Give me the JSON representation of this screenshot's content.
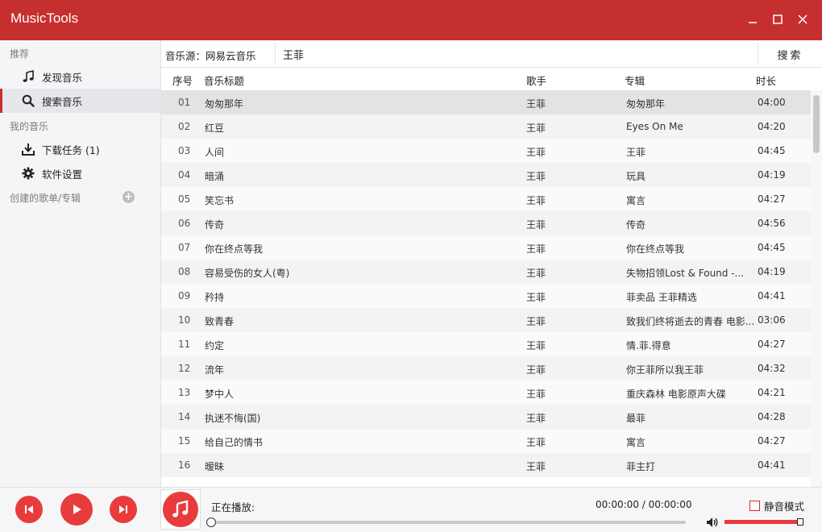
{
  "app": {
    "title": "MusicTools"
  },
  "window_controls": {
    "minimize": "minimize",
    "maximize": "maximize",
    "close": "close"
  },
  "sidebar": {
    "section_recommend": "推荐",
    "item_discover": "发现音乐",
    "item_search": "搜索音乐",
    "section_my_music": "我的音乐",
    "item_download": "下载任务 (1)",
    "item_settings": "软件设置",
    "section_playlists": "创建的歌单/专辑",
    "add_symbol": "+"
  },
  "search": {
    "source_label": "音乐源：网易云音乐",
    "query": "王菲",
    "button_label": "搜索"
  },
  "table": {
    "headers": {
      "index": "序号",
      "title": "音乐标题",
      "artist": "歌手",
      "album": "专辑",
      "duration": "时长"
    },
    "rows": [
      {
        "index": "01",
        "title": "匆匆那年",
        "artist": "王菲",
        "album": "匆匆那年",
        "duration": "04:00"
      },
      {
        "index": "02",
        "title": "红豆",
        "artist": "王菲",
        "album": "Eyes On Me",
        "duration": "04:20"
      },
      {
        "index": "03",
        "title": "人间",
        "artist": "王菲",
        "album": "王菲",
        "duration": "04:45"
      },
      {
        "index": "04",
        "title": "暗涌",
        "artist": "王菲",
        "album": "玩具",
        "duration": "04:19"
      },
      {
        "index": "05",
        "title": "笑忘书",
        "artist": "王菲",
        "album": "寓言",
        "duration": "04:27"
      },
      {
        "index": "06",
        "title": "传奇",
        "artist": "王菲",
        "album": "传奇",
        "duration": "04:56"
      },
      {
        "index": "07",
        "title": "你在终点等我",
        "artist": "王菲",
        "album": "你在终点等我",
        "duration": "04:45"
      },
      {
        "index": "08",
        "title": "容易受伤的女人(粤)",
        "artist": "王菲",
        "album": "失物招领Lost & Found -...",
        "duration": "04:19"
      },
      {
        "index": "09",
        "title": "矜持",
        "artist": "王菲",
        "album": "菲卖品 王菲精选",
        "duration": "04:41"
      },
      {
        "index": "10",
        "title": "致青春",
        "artist": "王菲",
        "album": "致我们终将逝去的青春 电影...",
        "duration": "03:06"
      },
      {
        "index": "11",
        "title": "约定",
        "artist": "王菲",
        "album": "情.菲.得意",
        "duration": "04:27"
      },
      {
        "index": "12",
        "title": "流年",
        "artist": "王菲",
        "album": "你王菲所以我王菲",
        "duration": "04:32"
      },
      {
        "index": "13",
        "title": "梦中人",
        "artist": "王菲",
        "album": "重庆森林 电影原声大碟",
        "duration": "04:21"
      },
      {
        "index": "14",
        "title": "执迷不悔(国)",
        "artist": "王菲",
        "album": "最菲",
        "duration": "04:28"
      },
      {
        "index": "15",
        "title": "给自己的情书",
        "artist": "王菲",
        "album": "寓言",
        "duration": "04:27"
      },
      {
        "index": "16",
        "title": "暧昧",
        "artist": "王菲",
        "album": "菲主打",
        "duration": "04:41"
      }
    ],
    "selected_row": 0
  },
  "player": {
    "now_playing_label": "正在播放:",
    "time": "00:00:00 / 00:00:00",
    "mute_label": "静音模式",
    "mute_checked": false,
    "progress": 0,
    "volume": 1.0
  },
  "colors": {
    "accent": "#c62f2f",
    "button_red": "#e83c3c",
    "sidebar_bg": "#f5f5f7"
  }
}
